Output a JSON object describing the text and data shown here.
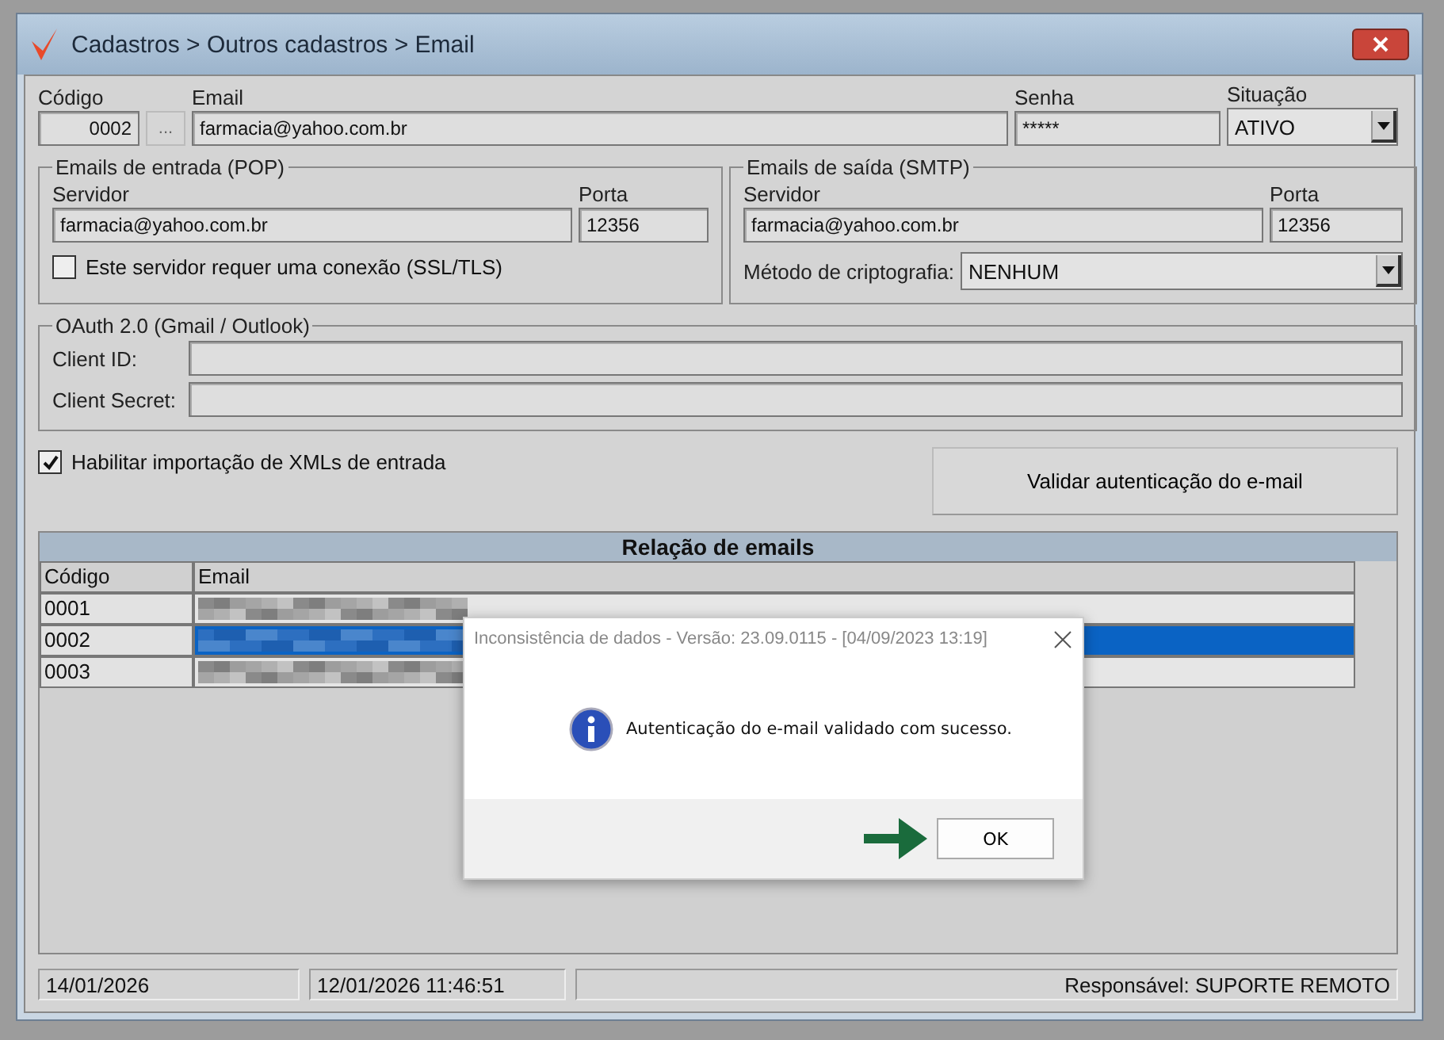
{
  "window": {
    "title": "Cadastros > Outros cadastros >  Email"
  },
  "form": {
    "codigo": {
      "label": "Código",
      "value": "0002"
    },
    "lookup_button": "...",
    "email": {
      "label": "Email",
      "value": "farmacia@yahoo.com.br"
    },
    "senha": {
      "label": "Senha",
      "value": "*****"
    },
    "situacao": {
      "label": "Situação",
      "value": "ATIVO"
    }
  },
  "pop": {
    "title": "Emails de entrada (POP)",
    "servidor": {
      "label": "Servidor",
      "value": "farmacia@yahoo.com.br"
    },
    "porta": {
      "label": "Porta",
      "value": "12356"
    },
    "ssl": {
      "label": "Este servidor requer uma conexão (SSL/TLS)",
      "checked": false
    }
  },
  "smtp": {
    "title": "Emails de saída (SMTP)",
    "servidor": {
      "label": "Servidor",
      "value": "farmacia@yahoo.com.br"
    },
    "porta": {
      "label": "Porta",
      "value": "12356"
    },
    "criptografia": {
      "label": "Método de criptografia:",
      "value": "NENHUM"
    }
  },
  "oauth": {
    "title": "OAuth 2.0 (Gmail / Outlook)",
    "client_id": {
      "label": "Client ID:"
    },
    "client_secret": {
      "label": "Client Secret:"
    }
  },
  "import_xml": {
    "label": "Habilitar importação de XMLs de entrada",
    "checked": true
  },
  "validate_button": "Validar autenticação do e-mail",
  "table": {
    "title": "Relação de emails",
    "columns": [
      "Código",
      "Email"
    ],
    "rows": [
      {
        "codigo": "0001",
        "selected": false
      },
      {
        "codigo": "0002",
        "selected": true
      },
      {
        "codigo": "0003",
        "selected": false
      }
    ]
  },
  "status_bar": [
    "14/01/2026",
    "12/01/2026 11:46:51",
    "Responsável: SUPORTE REMOTO"
  ],
  "dialog": {
    "title": "Inconsistência de dados - Versão: 23.09.0115 - [04/09/2023 13:19]",
    "message": "Autenticação do e-mail validado com sucesso.",
    "button": "OK"
  }
}
